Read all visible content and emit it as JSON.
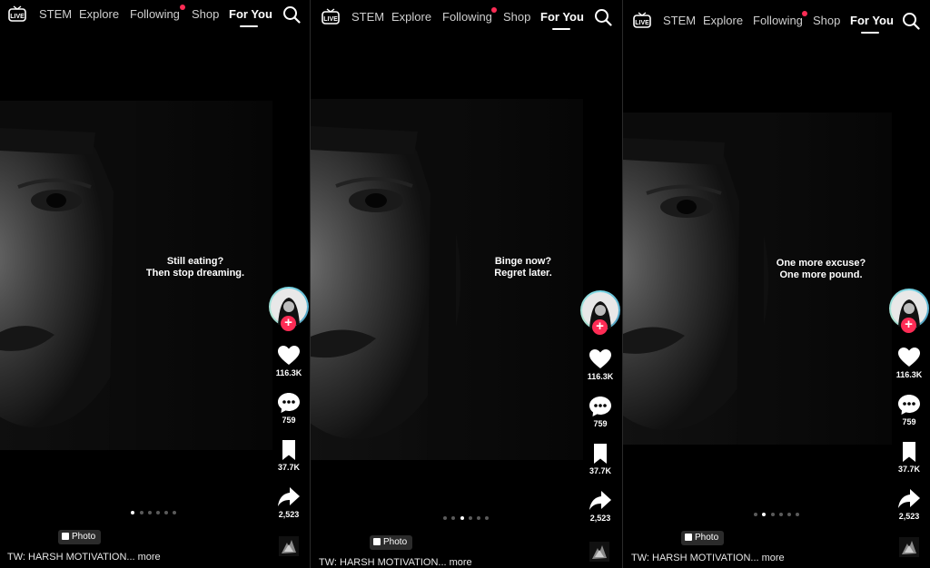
{
  "nav": {
    "live_label": "LIVE",
    "items": [
      "STEM",
      "Explore",
      "Following",
      "Shop",
      "For You"
    ],
    "active": "For You",
    "notification_on": "Following"
  },
  "panels": [
    {
      "quote_line1": "Still eating?",
      "quote_line2": "Then stop dreaming.",
      "likes": "116.3K",
      "comments": "759",
      "saves": "37.7K",
      "shares": "2,523",
      "badge": "Photo",
      "caption": "TW: HARSH MOTIVATION... more",
      "active_dot": 1,
      "dot_count": 6
    },
    {
      "quote_line1": "Binge now?",
      "quote_line2": "Regret later.",
      "likes": "116.3K",
      "comments": "759",
      "saves": "37.7K",
      "shares": "2,523",
      "badge": "Photo",
      "caption": "TW: HARSH MOTIVATION... more",
      "active_dot": 3,
      "dot_count": 6
    },
    {
      "quote_line1": "One more excuse?",
      "quote_line2": "One more pound.",
      "likes": "116.3K",
      "comments": "759",
      "saves": "37.7K",
      "shares": "2,523",
      "badge": "Photo",
      "caption": "TW: HARSH MOTIVATION... more",
      "active_dot": 2,
      "dot_count": 6
    }
  ],
  "colors": {
    "accent": "#fe2c55",
    "background": "#000000",
    "ring": "#7ad7e6"
  },
  "icons": [
    "live-icon",
    "search-icon",
    "heart-icon",
    "comment-icon",
    "bookmark-icon",
    "share-icon",
    "photo-icon",
    "music-disc-icon",
    "plus-icon"
  ]
}
